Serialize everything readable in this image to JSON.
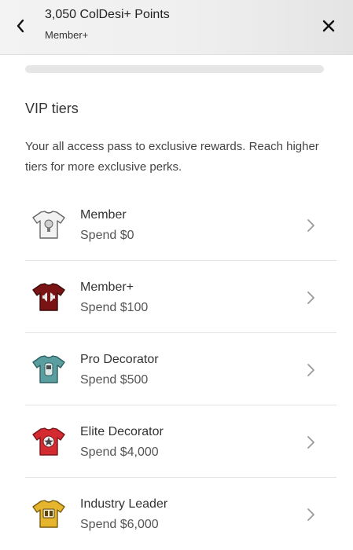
{
  "header": {
    "title": "3,050 ColDesi+ Points",
    "subtitle": "Member+",
    "back_icon": "chevron-left-icon",
    "close_icon": "close-icon"
  },
  "progress": {
    "fraction": 0
  },
  "vip": {
    "title": "VIP tiers",
    "description": "Your all access pass to exclusive rewards. Reach higher tiers for more exclusive perks."
  },
  "tiers": [
    {
      "name": "Member",
      "spend": "Spend $0",
      "icon": "white-tshirt-icon",
      "color": "#f2f2f2"
    },
    {
      "name": "Member+",
      "spend": "Spend $100",
      "icon": "maroon-tshirt-icon",
      "color": "#7a1414"
    },
    {
      "name": "Pro Decorator",
      "spend": "Spend $500",
      "icon": "teal-tshirt-icon",
      "color": "#5a9ea0"
    },
    {
      "name": "Elite Decorator",
      "spend": "Spend $4,000",
      "icon": "red-tshirt-icon",
      "color": "#d42b31"
    },
    {
      "name": "Industry Leader",
      "spend": "Spend $6,000",
      "icon": "gold-tshirt-icon",
      "color": "#e6b52e"
    }
  ]
}
